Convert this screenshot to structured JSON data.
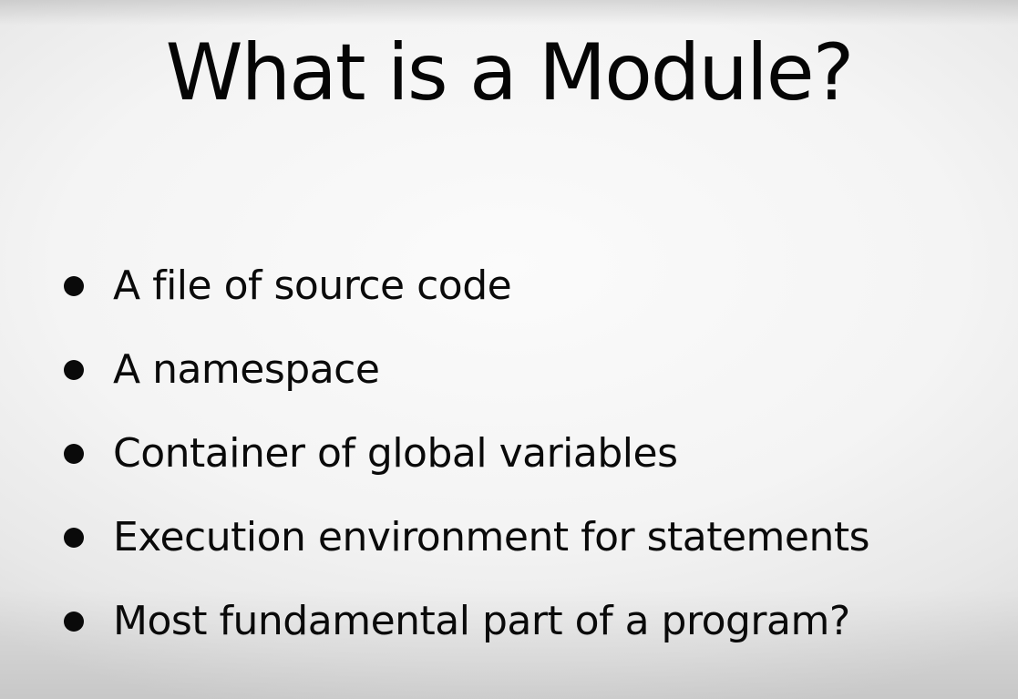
{
  "slide": {
    "title": "What is a Module?",
    "bullets": [
      "A file of source code",
      "A namespace",
      "Container of global variables",
      "Execution environment for statements",
      "Most fundamental part of a program?"
    ]
  }
}
